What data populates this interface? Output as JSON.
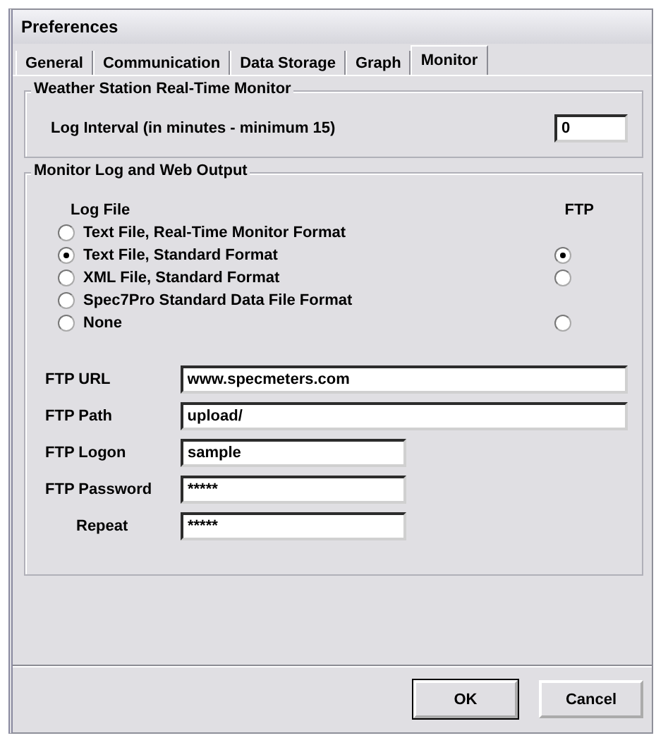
{
  "window": {
    "title": "Preferences"
  },
  "tabs": [
    {
      "label": "General",
      "selected": false
    },
    {
      "label": "Communication",
      "selected": false
    },
    {
      "label": "Data Storage",
      "selected": false
    },
    {
      "label": "Graph",
      "selected": false
    },
    {
      "label": "Monitor",
      "selected": true
    }
  ],
  "realtime_group": {
    "title": "Weather Station Real-Time Monitor",
    "log_interval": {
      "label": "Log Interval (in minutes - minimum 15)",
      "value": "0"
    }
  },
  "output_group": {
    "title": "Monitor Log and Web Output",
    "log_file_heading": "Log File",
    "ftp_heading": "FTP",
    "options": [
      {
        "label": "Text File, Real-Time Monitor Format",
        "selected": false
      },
      {
        "label": "Text File, Standard Format",
        "selected": true,
        "ftp": {
          "selected": true
        }
      },
      {
        "label": "XML File, Standard Format",
        "selected": false,
        "ftp": {
          "selected": false
        }
      },
      {
        "label": "Spec7Pro Standard Data File Format",
        "selected": false
      },
      {
        "label": "None",
        "selected": false,
        "ftp": {
          "selected": false
        }
      }
    ],
    "fields": [
      {
        "label": "FTP URL",
        "value": "www.specmeters.com",
        "kind": "wide"
      },
      {
        "label": "FTP Path",
        "value": "upload/",
        "kind": "wide"
      },
      {
        "label": "FTP Logon",
        "value": "sample",
        "kind": "short"
      },
      {
        "label": "FTP Password",
        "value": "*****",
        "kind": "short"
      },
      {
        "label": "Repeat",
        "value": "*****",
        "kind": "indented"
      }
    ]
  },
  "buttons": [
    {
      "label": "OK",
      "default": true
    },
    {
      "label": "Cancel",
      "default": false
    }
  ]
}
